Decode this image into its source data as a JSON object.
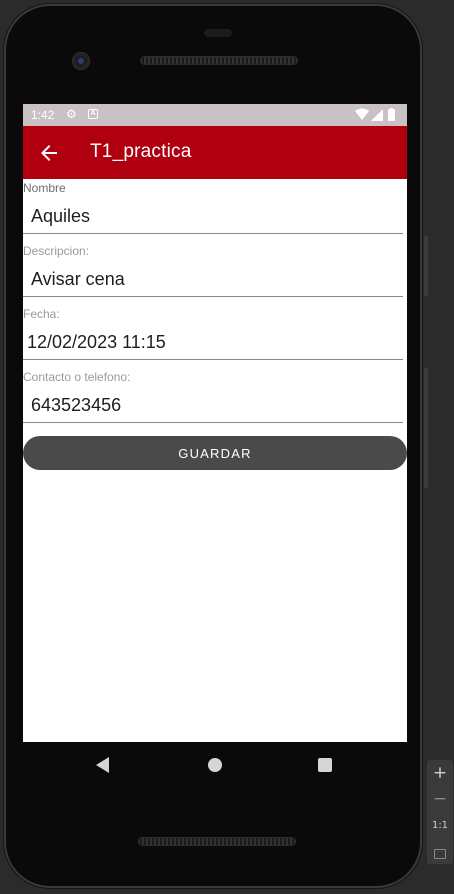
{
  "status_bar": {
    "time": "1:42",
    "icons": [
      "gear-icon",
      "a-badge-icon",
      "wifi-icon",
      "signal-icon",
      "battery-icon"
    ]
  },
  "app_bar": {
    "title": "T1_practica",
    "back_icon": "arrow-left-icon",
    "color": "#b0000f"
  },
  "form": {
    "fields": [
      {
        "label": "Nombre",
        "value": "Aquiles"
      },
      {
        "label": "Descripcion:",
        "value": "Avisar cena"
      },
      {
        "label": "Fecha:",
        "value": "12/02/2023 11:15"
      },
      {
        "label": "Contacto o telefono:",
        "value": "643523456"
      }
    ],
    "save_label": "GUARDAR"
  },
  "nav_bar": {
    "icons": [
      "nav-back-icon",
      "nav-home-icon",
      "nav-recents-icon"
    ]
  },
  "zoom_panel": {
    "zoom_in": "+",
    "zoom_out": "−",
    "actual_size": "1:1"
  }
}
